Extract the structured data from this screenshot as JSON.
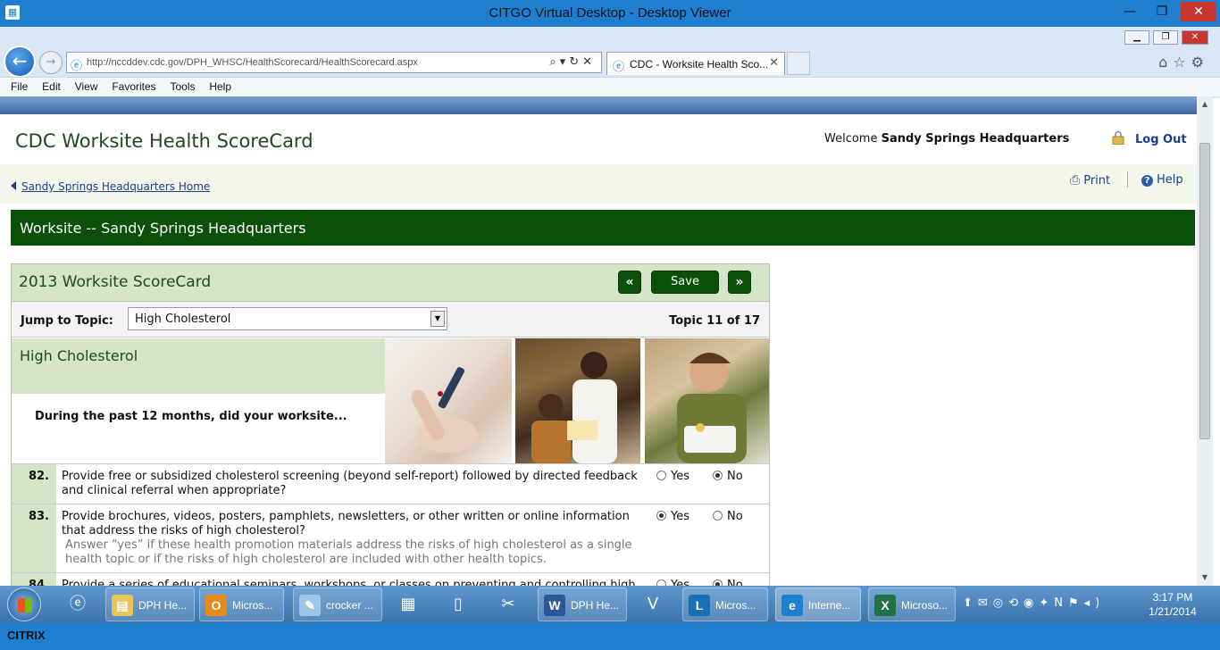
{
  "citrix": {
    "window_title": "CITGO Virtual Desktop - Desktop Viewer",
    "brand": "CITRIX"
  },
  "browser": {
    "url": "http://nccddev.cdc.gov/DPH_WHSC/HealthScorecard/HealthScorecard.aspx",
    "tab_title": "CDC - Worksite Health Sco...",
    "menu": [
      "File",
      "Edit",
      "View",
      "Favorites",
      "Tools",
      "Help"
    ]
  },
  "header": {
    "site_title": "CDC Worksite Health ScoreCard",
    "welcome_prefix": "Welcome",
    "user_name": "Sandy Springs Headquarters",
    "logout_label": "Log Out",
    "breadcrumb": "Sandy Springs Headquarters Home",
    "print_label": "Print",
    "help_label": "Help"
  },
  "banner": {
    "title": "Worksite -- Sandy Springs Headquarters"
  },
  "scorecard": {
    "title": "2013 Worksite ScoreCard",
    "prev_label": "«",
    "save_label": "Save",
    "next_label": "»",
    "jump_label": "Jump to Topic:",
    "jump_selected": "High Cholesterol",
    "topic_counter": "Topic 11 of 17",
    "topic_name": "High Cholesterol",
    "intro": "During the past 12 months, did your worksite...",
    "yes_label": "Yes",
    "no_label": "No",
    "questions": [
      {
        "num": "82.",
        "text": "Provide free or subsidized cholesterol screening (beyond self-report) followed by directed feedback and clinical referral when appropriate?",
        "note": "",
        "answer": "No"
      },
      {
        "num": "83.",
        "text": "Provide brochures, videos, posters, pamphlets, newsletters, or other written or online information that address the risks of high cholesterol?",
        "note": "Answer “yes” if these health promotion materials address the risks of high cholesterol as a single health topic or if the risks of high cholesterol are included with other health topics.",
        "answer": "Yes"
      },
      {
        "num": "84.",
        "text": "Provide a series of educational seminars, workshops, or classes on preventing and controlling high",
        "note": "",
        "answer": "No"
      }
    ]
  },
  "taskbar": {
    "items": [
      "DPH He...",
      "Micros...",
      "crocker ...",
      "DPH He...",
      "Micros...",
      "Interne...",
      "Microso..."
    ],
    "time": "3:17 PM",
    "date": "1/21/2014"
  }
}
